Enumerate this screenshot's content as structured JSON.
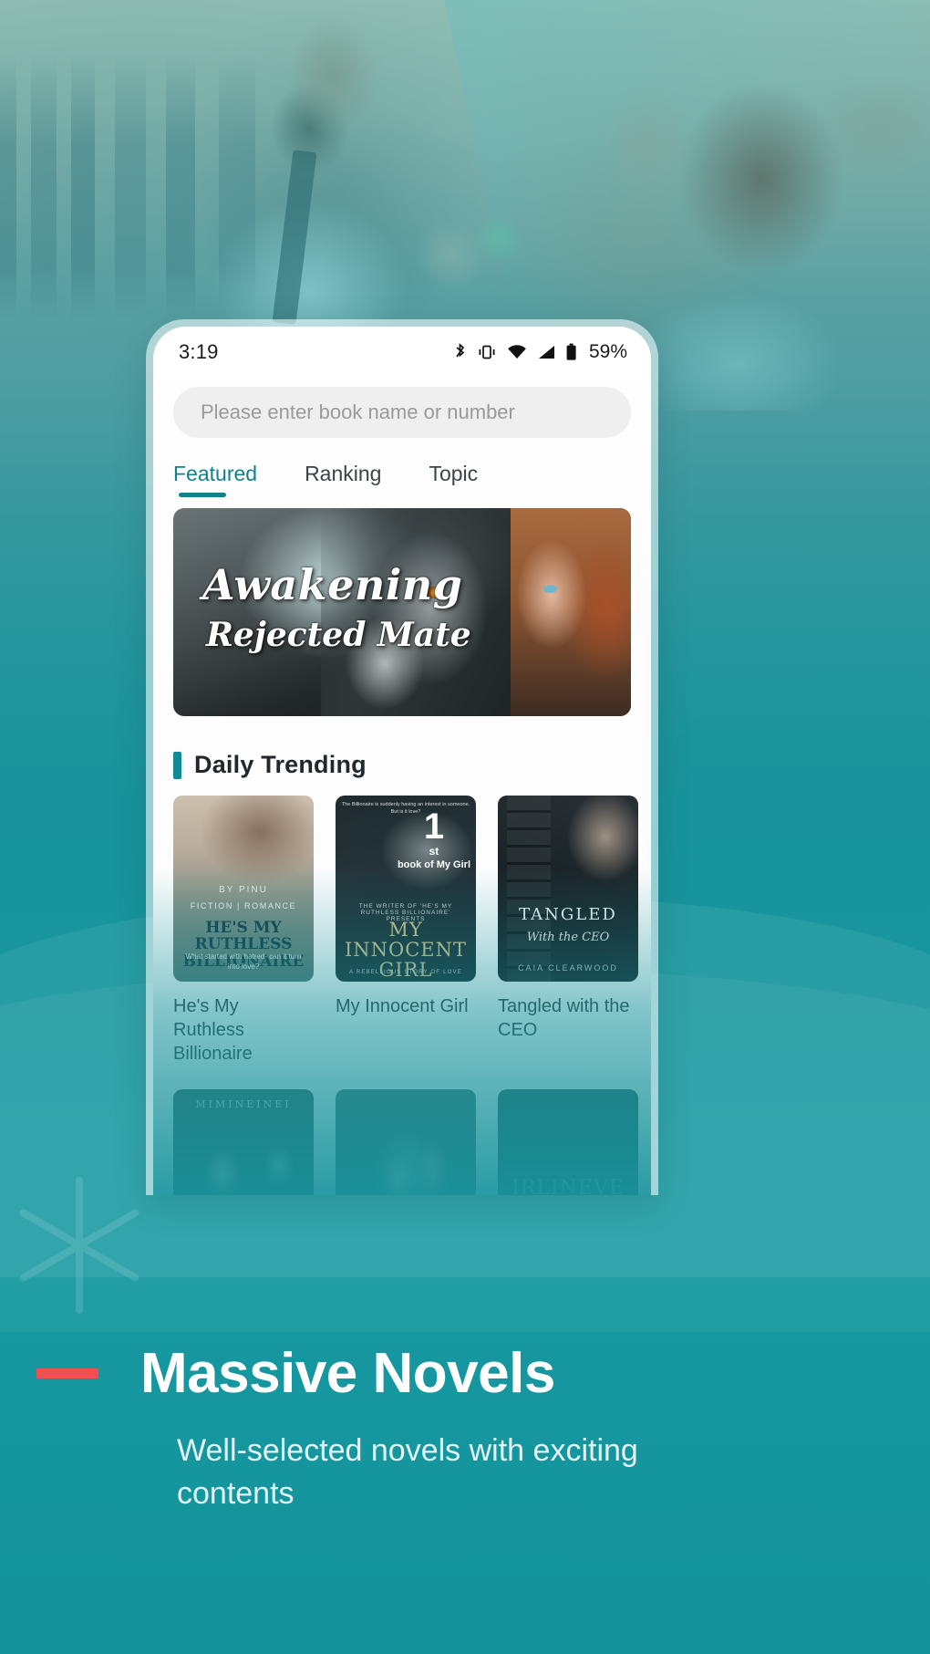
{
  "phone": {
    "status": {
      "time": "3:19",
      "battery": "59%",
      "icons": [
        "bluetooth-icon",
        "vibrate-icon",
        "wifi-icon",
        "signal-icon",
        "battery-icon"
      ]
    },
    "search": {
      "placeholder": "Please enter book name or number"
    },
    "tabs": [
      {
        "label": "Featured",
        "active": true
      },
      {
        "label": "Ranking",
        "active": false
      },
      {
        "label": "Topic",
        "active": false
      }
    ],
    "banner": {
      "title": "Awakening",
      "subtitle": "Rejected Mate"
    },
    "section": {
      "title": "Daily Trending"
    },
    "books": [
      {
        "title": "He's My Ruthless Billionaire",
        "cover": {
          "by": "BY PINU",
          "genre": "FICTION | ROMANCE",
          "headline": "HE'S MY RUTHLESS BILLIONAIRE",
          "tagline": "What started with hatred- can it turn into love?"
        }
      },
      {
        "title": "My Innocent Girl",
        "cover": {
          "hook": "The Billionaire is suddenly having an interest in someone. But is it love?",
          "presents": "THE WRITER OF  'HE'S MY RUTHLESS BILLIONAIRE'  PRESENTS",
          "headline": "MY INNOCENT GIRL",
          "footer": "A REBELLIOUS STORY OF LOVE",
          "badge_number": "1",
          "badge_ordinal": "st",
          "badge_text": "book of My Girl"
        }
      },
      {
        "title": "Tangled with the CEO",
        "cover": {
          "headline": "TANGLED",
          "subhead": "With the CEO",
          "author": "CAIA CLEARWOOD"
        }
      }
    ],
    "books_row2": [
      {
        "title_overlay": "MIMINEINEI"
      },
      {
        "title_overlay": ""
      },
      {
        "title_overlay": "IRLINEVE"
      }
    ]
  },
  "promo": {
    "title": "Massive Novels",
    "subtitle": "Well-selected novels with exciting contents"
  },
  "colors": {
    "brand_teal": "#18949c",
    "accent_teal": "#11818c",
    "accent_red": "#f2504f",
    "text_dark": "#20282b"
  }
}
